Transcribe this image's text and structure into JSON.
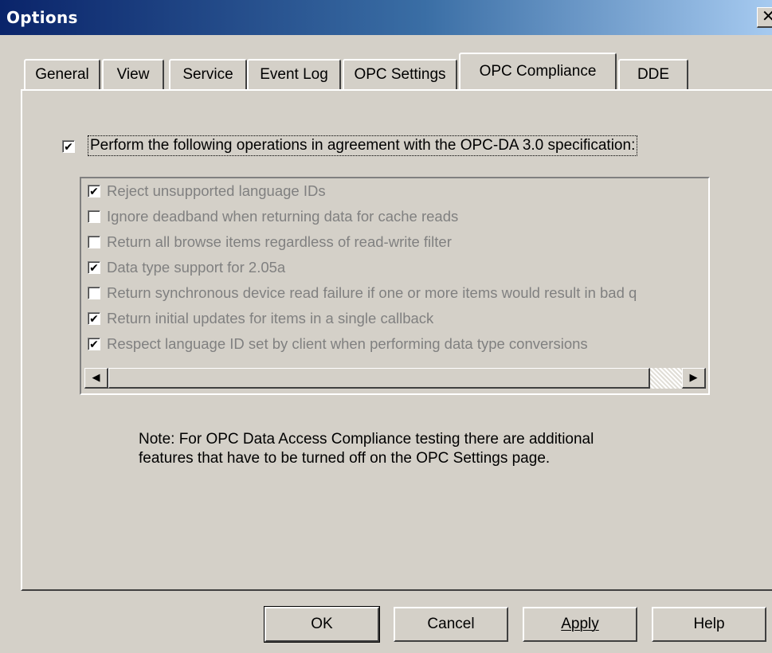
{
  "window": {
    "title": "Options",
    "close_glyph": "✕"
  },
  "tabs": [
    {
      "label": "General"
    },
    {
      "label": "View"
    },
    {
      "label": "Service"
    },
    {
      "label": "Event Log"
    },
    {
      "label": "OPC Settings"
    },
    {
      "label": "OPC Compliance"
    },
    {
      "label": "DDE"
    }
  ],
  "active_tab": "OPC Compliance",
  "compliance": {
    "main_checkbox": {
      "label": "Perform the following operations in agreement with the OPC-DA 3.0 specification:",
      "checked": true,
      "glyph": "✔"
    },
    "items": [
      {
        "label": "Reject unsupported language IDs",
        "checked": true,
        "glyph": "✔"
      },
      {
        "label": "Ignore deadband when returning data for cache reads",
        "checked": false,
        "glyph": ""
      },
      {
        "label": "Return all browse items regardless of read-write filter",
        "checked": false,
        "glyph": ""
      },
      {
        "label": "Data type support for 2.05a",
        "checked": true,
        "glyph": "✔"
      },
      {
        "label": "Return synchronous device read failure if one or more items would result in bad q",
        "checked": false,
        "glyph": ""
      },
      {
        "label": "Return initial updates for items in a single callback",
        "checked": true,
        "glyph": "✔"
      },
      {
        "label": "Respect language ID set by client when performing data type conversions",
        "checked": true,
        "glyph": "✔"
      }
    ],
    "scroll": {
      "left_glyph": "◀",
      "right_glyph": "▶",
      "position": 0.0
    },
    "note_line1": "Note: For OPC Data Access Compliance testing there are additional",
    "note_line2": "features that have to be turned off on the OPC Settings page."
  },
  "buttons": {
    "ok": "OK",
    "cancel": "Cancel",
    "apply": "Apply",
    "help": "Help"
  },
  "colors": {
    "face": "#d4d0c8",
    "title_start": "#0a246a",
    "title_end": "#a6caf0",
    "disabled_text": "#808080"
  }
}
